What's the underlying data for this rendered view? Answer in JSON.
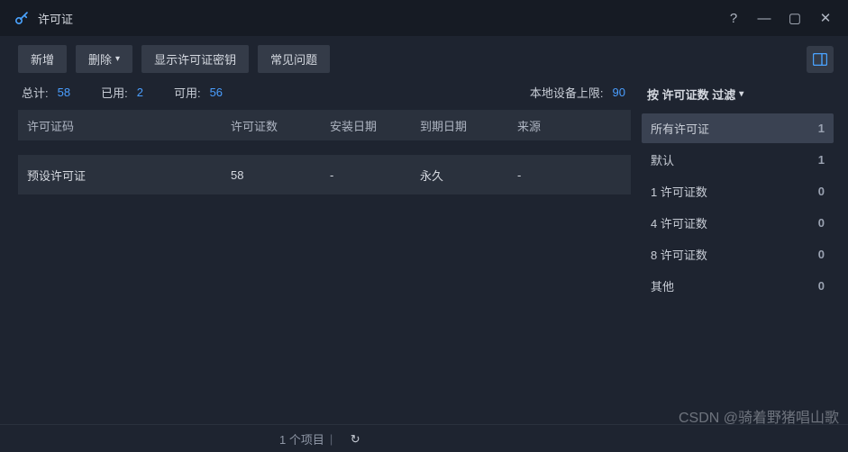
{
  "window": {
    "title": "许可证",
    "help_icon": "?",
    "minimize_icon": "—",
    "maximize_icon": "▢",
    "close_icon": "✕"
  },
  "toolbar": {
    "add_label": "新增",
    "delete_label": "删除",
    "show_key_label": "显示许可证密钥",
    "faq_label": "常见问题"
  },
  "stats": {
    "total_label": "总计:",
    "total_value": "58",
    "used_label": "已用:",
    "used_value": "2",
    "avail_label": "可用:",
    "avail_value": "56",
    "device_limit_label": "本地设备上限:",
    "device_limit_value": "90"
  },
  "table": {
    "headers": {
      "code": "许可证码",
      "count": "许可证数",
      "install": "安装日期",
      "expire": "到期日期",
      "source": "来源"
    },
    "row": {
      "code": "预设许可证",
      "count": "58",
      "install": "-",
      "expire": "永久",
      "source": "-"
    }
  },
  "filter": {
    "title": "按 许可证数 过滤",
    "items": [
      {
        "label": "所有许可证",
        "count": "1"
      },
      {
        "label": "默认",
        "count": "1"
      },
      {
        "label": "1 许可证数",
        "count": "0"
      },
      {
        "label": "4 许可证数",
        "count": "0"
      },
      {
        "label": "8 许可证数",
        "count": "0"
      },
      {
        "label": "其他",
        "count": "0"
      }
    ]
  },
  "statusbar": {
    "items_text": "1 个项目",
    "refresh_icon": "↻"
  },
  "watermark": "CSDN @骑着野猪唱山歌"
}
